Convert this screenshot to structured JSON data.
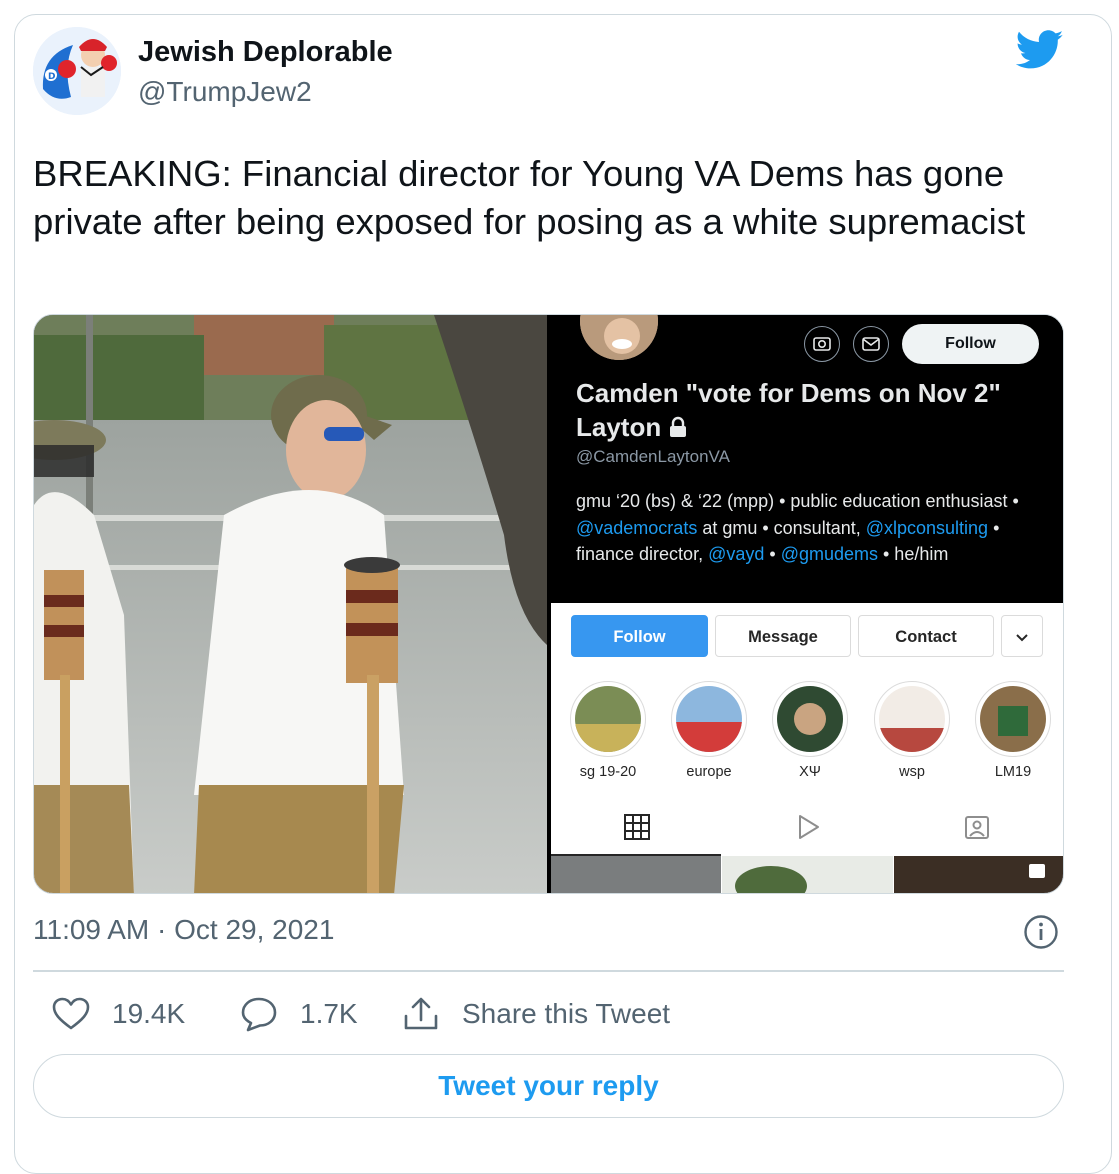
{
  "author": {
    "name": "Jewish Deplorable",
    "handle": "@TrumpJew2"
  },
  "tweet": {
    "text": "BREAKING: Financial director for Young VA Dems has gone private after being exposed for posing as a white supremacist",
    "timestamp": "11:09 AM · Oct 29, 2021"
  },
  "profile_screenshot": {
    "follow_label": "Follow",
    "name": "Camden \"vote for Dems on Nov 2\" Layton",
    "handle": "@CamdenLaytonVA",
    "bio": {
      "t1": "gmu ‘20 (bs) & ‘22 (mpp) • public education enthusiast • ",
      "m1": "@vademocrats",
      "t2": " at gmu • consultant, ",
      "m2": "@xlpconsulting",
      "t3": " • finance director, ",
      "m3": "@vayd",
      "t4": " • ",
      "m4": "@gmudems",
      "t5": " • he/him"
    },
    "buttons": {
      "follow": "Follow",
      "message": "Message",
      "contact": "Contact"
    },
    "highlights": [
      "sg 19-20",
      "europe",
      "XΨ",
      "wsp",
      "LM19"
    ]
  },
  "stats": {
    "likes": "19.4K",
    "replies": "1.7K",
    "share_label": "Share this Tweet"
  },
  "reply_prompt": "Tweet your reply",
  "colors": {
    "twitter_blue": "#1d9bf0",
    "secondary_text": "#536471",
    "border": "#cfd9de",
    "instagram_blue": "#3797f0"
  }
}
